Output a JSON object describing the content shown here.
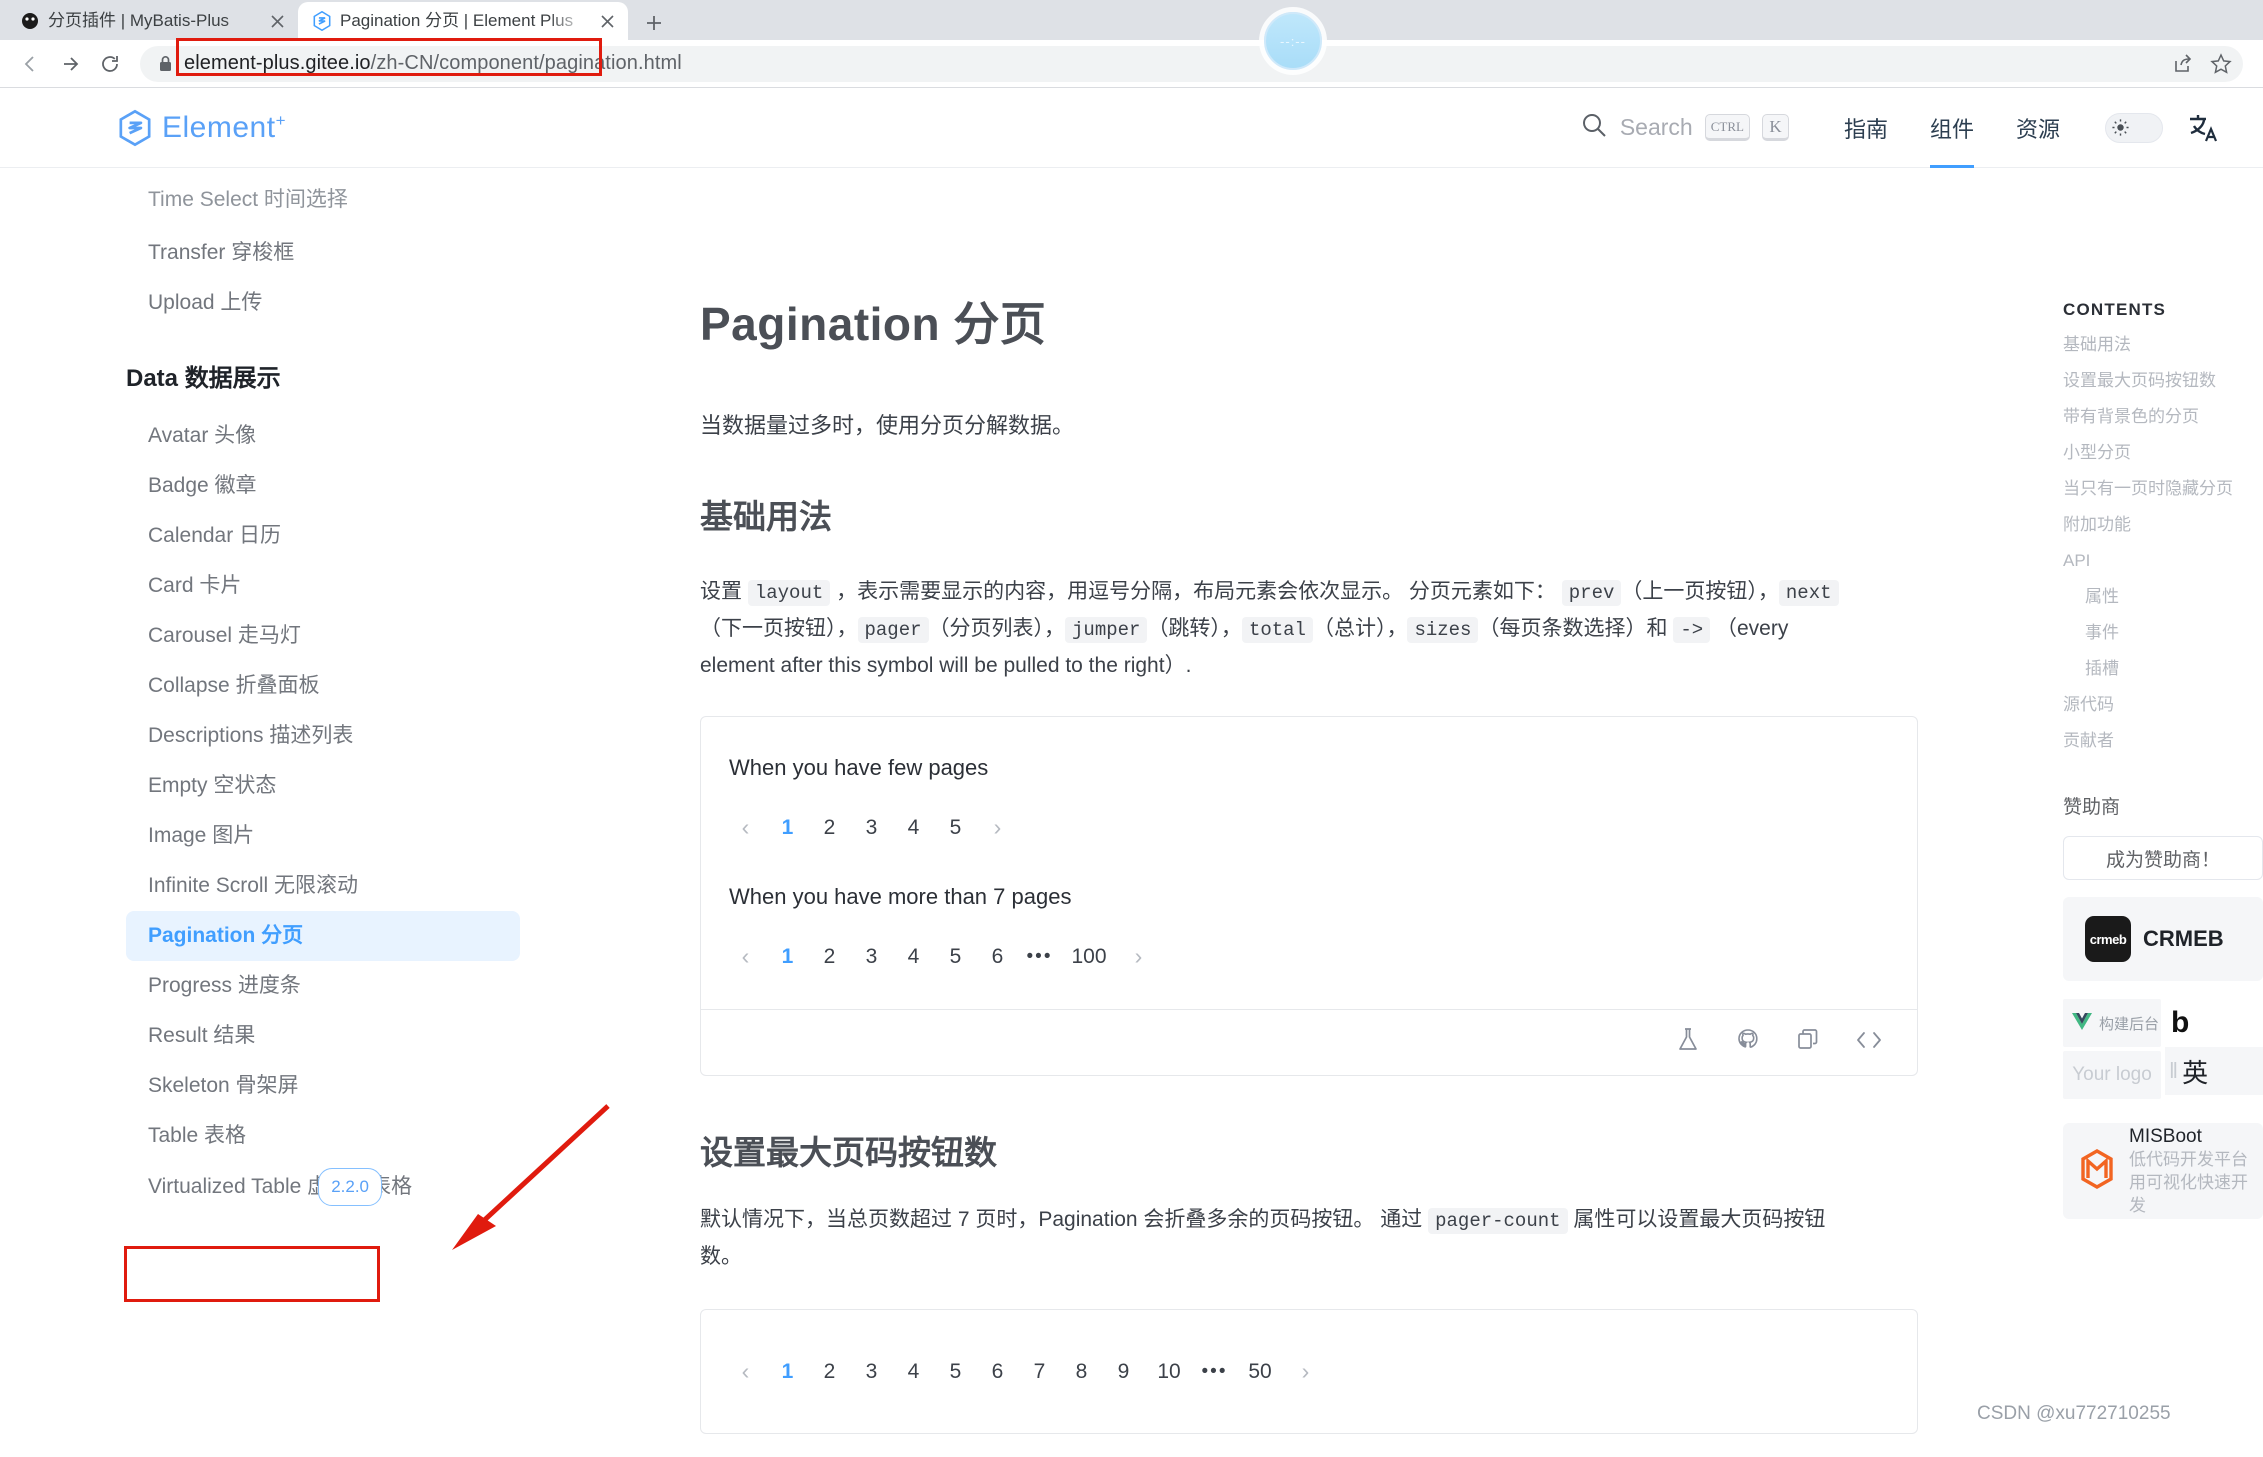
{
  "browser": {
    "tabs": [
      {
        "title": "分页插件 | MyBatis-Plus",
        "active": false,
        "favicon": "mybatis-favicon"
      },
      {
        "title": "Pagination 分页 | Element Plus",
        "active": true,
        "favicon": "element-plus-favicon"
      }
    ],
    "new_tab_label": "+",
    "url_prefix": "element-plus.gitee.io",
    "url_suffix": "/zh-CN/component/pagination.html",
    "clock_bubble": "--:--"
  },
  "header": {
    "brand": "Element",
    "brand_plus": "+",
    "search_placeholder": "Search",
    "kbd_ctrl": "CTRL",
    "kbd_k": "K",
    "nav": [
      {
        "label": "指南",
        "active": false
      },
      {
        "label": "组件",
        "active": true
      },
      {
        "label": "资源",
        "active": false
      }
    ]
  },
  "sidebar": {
    "top_items": [
      {
        "label": "Time Select 时间选择",
        "clipped": true
      },
      {
        "label": "Transfer 穿梭框"
      },
      {
        "label": "Upload 上传"
      }
    ],
    "group_title": "Data 数据展示",
    "items": [
      {
        "label": "Avatar 头像"
      },
      {
        "label": "Badge 徽章"
      },
      {
        "label": "Calendar 日历"
      },
      {
        "label": "Card 卡片"
      },
      {
        "label": "Carousel 走马灯"
      },
      {
        "label": "Collapse 折叠面板"
      },
      {
        "label": "Descriptions 描述列表"
      },
      {
        "label": "Empty 空状态"
      },
      {
        "label": "Image 图片"
      },
      {
        "label": "Infinite Scroll 无限滚动"
      },
      {
        "label": "Pagination 分页",
        "active": true
      },
      {
        "label": "Progress 进度条"
      },
      {
        "label": "Result 结果"
      },
      {
        "label": "Skeleton 骨架屏"
      },
      {
        "label": "Table 表格"
      },
      {
        "label": "Virtualized Table 虚拟化表格",
        "badge": "2.2.0"
      }
    ]
  },
  "main": {
    "title": "Pagination 分页",
    "lede": "当数据量过多时，使用分页分解数据。",
    "section1": {
      "heading": "基础用法",
      "paragraph": {
        "p1": "设置 ",
        "c1": "layout",
        "p2": " ，表示需要显示的内容，用逗号分隔，布局元素会依次显示。 分页元素如下：",
        "c2": "prev",
        "p3": "（上一页按钮），",
        "c3": "next",
        "p4": "（下一页按钮），",
        "c4": "pager",
        "p5": "（分页列表），",
        "c5": "jumper",
        "p6": "（跳转），",
        "c6": "total",
        "p7": "（总计），",
        "c7": "sizes",
        "p8": "（每页条数选择）和",
        "c8": "->",
        "p9": "（every element after this symbol will be pulled to the right）."
      },
      "demo": {
        "label_a": "When you have few pages",
        "pager_a": {
          "prev": "‹",
          "pages": [
            "1",
            "2",
            "3",
            "4",
            "5"
          ],
          "current": "1",
          "next": "›"
        },
        "label_b": "When you have more than 7 pages",
        "pager_b": {
          "prev": "‹",
          "pages": [
            "1",
            "2",
            "3",
            "4",
            "5",
            "6",
            "•••",
            "100"
          ],
          "current": "1",
          "next": "›"
        }
      },
      "footer_icons": [
        "flask-icon",
        "github-icon",
        "copy-icon",
        "code-icon"
      ]
    },
    "section2": {
      "heading": "设置最大页码按钮数",
      "paragraph": {
        "p1": "默认情况下，当总页数超过 7 页时，Pagination 会折叠多余的页码按钮。 通过 ",
        "c1": "pager-count",
        "p2": " 属性可以设置最大页码按钮数。"
      },
      "demo": {
        "pager": {
          "prev": "‹",
          "pages": [
            "1",
            "2",
            "3",
            "4",
            "5",
            "6",
            "7",
            "8",
            "9",
            "10",
            "•••",
            "50"
          ],
          "current": "1",
          "next": "›"
        }
      }
    }
  },
  "rightbar": {
    "contents_title": "CONTENTS",
    "toc": [
      {
        "label": "基础用法",
        "indent": false
      },
      {
        "label": "设置最大页码按钮数",
        "indent": false
      },
      {
        "label": "带有背景色的分页",
        "indent": false
      },
      {
        "label": "小型分页",
        "indent": false
      },
      {
        "label": "当只有一页时隐藏分页",
        "indent": false
      },
      {
        "label": "附加功能",
        "indent": false
      },
      {
        "label": "API",
        "indent": false
      },
      {
        "label": "属性",
        "indent": true
      },
      {
        "label": "事件",
        "indent": true
      },
      {
        "label": "插槽",
        "indent": true
      },
      {
        "label": "源代码",
        "indent": false
      },
      {
        "label": "贡献者",
        "indent": false
      }
    ],
    "sponsor_title": "赞助商",
    "sponsor_button": "成为赞助商！",
    "sponsors": {
      "crmeb_logo_text": "crmeb",
      "crmeb_name": "CRMEB",
      "vue_admin_label": "构建后台",
      "your_logo_label": "Your logo",
      "bili_label": "b",
      "ying_label": "英",
      "misboot_name": "MISBoot",
      "misboot_line1": "低代码开发平台",
      "misboot_line2": "用可视化快速开发"
    },
    "watermark": "CSDN @xu772710255"
  },
  "colors": {
    "accent": "#409eff",
    "annotation_red": "#e01b0e",
    "text": "#3c4149",
    "muted": "#b4b8bf"
  }
}
